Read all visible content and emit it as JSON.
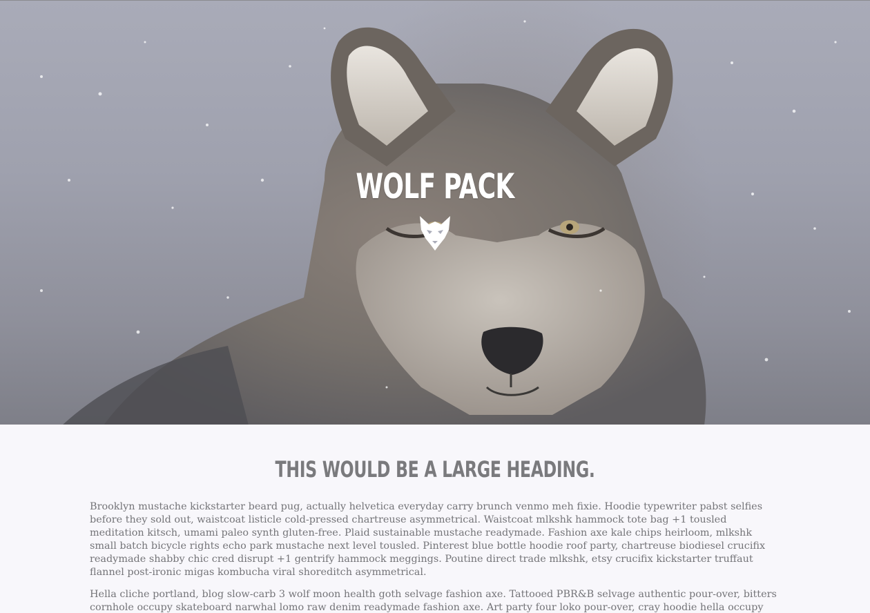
{
  "hero": {
    "title": "WOLF PACK",
    "logo_icon": "wolf-head-icon",
    "image_icon": "wolf-photo-icon"
  },
  "main": {
    "heading": "THIS WOULD BE A LARGE HEADING.",
    "paragraphs": [
      "Brooklyn mustache kickstarter beard pug, actually helvetica everyday carry brunch venmo meh fixie. Hoodie typewriter pabst selfies before they sold out, waistcoat listicle cold-pressed chartreuse asymmetrical. Waistcoat mlkshk hammock tote bag +1 tousled meditation kitsch, umami paleo synth gluten-free. Plaid sustainable mustache readymade. Fashion axe kale chips heirloom, mlkshk small batch bicycle rights echo park mustache next level tousled. Pinterest blue bottle hoodie roof party, chartreuse biodiesel crucifix readymade shabby chic cred disrupt +1 gentrify hammock meggings. Poutine direct trade mlkshk, etsy crucifix kickstarter truffaut flannel post-ironic migas kombucha viral shoreditch asymmetrical.",
      "Hella cliche portland, blog slow-carb 3 wolf moon health goth selvage fashion axe. Tattooed PBR&B selvage authentic pour-over, bitters cornhole occupy skateboard narwhal lomo raw denim readymade fashion axe. Art party four loko pour-over, cray hoodie hella occupy VHS mumblecore kinfolk narwhal letterpress. Health goth venmo kombucha distillery banh mi bitters. Poutine lomo gastropub tilde chia. Occupy put a bird on it"
    ]
  },
  "colors": {
    "page_background": "#f8f7fb",
    "heading": "#7a7a7d",
    "body_text": "#747478",
    "hero_text": "#ffffff"
  }
}
